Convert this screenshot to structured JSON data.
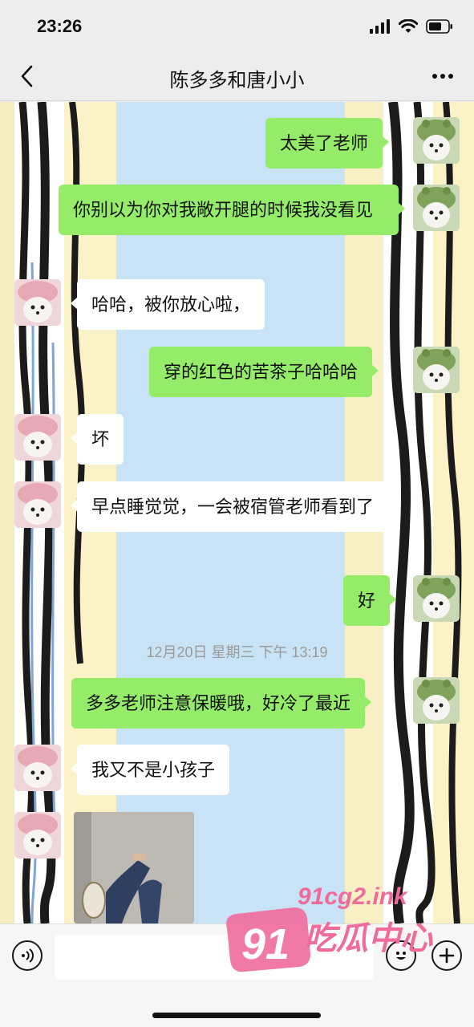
{
  "status_bar": {
    "time": "23:26",
    "signal_icon": "signal-icon",
    "wifi_icon": "wifi-icon",
    "battery_icon": "battery-icon"
  },
  "nav": {
    "back_icon": "chevron-left-icon",
    "title": "陈多多和唐小小",
    "more_icon": "more-icon"
  },
  "messages": [
    {
      "side": "right",
      "text": "太美了老师"
    },
    {
      "side": "right",
      "text": "你别以为你对我敞开腿的时候我没看见"
    },
    {
      "side": "left",
      "text": "哈哈，被你放心啦，"
    },
    {
      "side": "right",
      "text": "穿的红色的苦茶子哈哈哈"
    },
    {
      "side": "left",
      "text": "坏"
    },
    {
      "side": "left",
      "text": "早点睡觉觉，一会被宿管老师看到了"
    },
    {
      "side": "right",
      "text": "好"
    },
    {
      "side": "right",
      "text": "多多老师注意保暖哦，好冷了最近"
    },
    {
      "side": "left",
      "text": "我又不是小孩子"
    },
    {
      "side": "left",
      "type": "image"
    }
  ],
  "timestamp": "12月20日 星期三 下午 13:19",
  "input_bar": {
    "voice_icon": "voice-icon",
    "emoji_icon": "emoji-icon",
    "plus_icon": "plus-icon",
    "input_value": ""
  },
  "watermark": {
    "number": "91",
    "domain": "91cg2.ink",
    "name": "吃瓜中心"
  },
  "colors": {
    "sent_bubble": "#95ec69",
    "received_bubble": "#ffffff",
    "background": "#ededed",
    "watermark": "#f06a9b"
  }
}
